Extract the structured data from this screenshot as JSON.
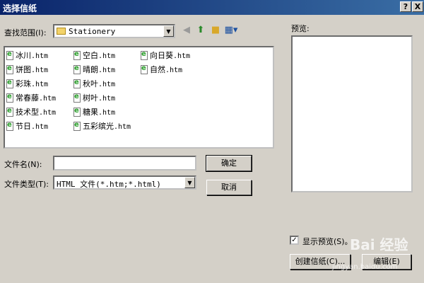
{
  "window": {
    "title": "选择信纸",
    "help": "?",
    "close": "X"
  },
  "lookin": {
    "label": "查找范围(I):",
    "value": "Stationery"
  },
  "files": [
    {
      "name": "冰川",
      "ext": ".htm"
    },
    {
      "name": "饼图",
      "ext": ".htm"
    },
    {
      "name": "彩珠",
      "ext": ".htm"
    },
    {
      "name": "常春藤",
      "ext": ".htm"
    },
    {
      "name": "技术型",
      "ext": ".htm"
    },
    {
      "name": "节日",
      "ext": ".htm"
    },
    {
      "name": "空白",
      "ext": ".htm"
    },
    {
      "name": "晴朗",
      "ext": ".htm"
    },
    {
      "name": "秋叶",
      "ext": ".htm"
    },
    {
      "name": "树叶",
      "ext": ".htm"
    },
    {
      "name": "糖果",
      "ext": ".htm"
    },
    {
      "name": "五彩缤光",
      "ext": ".htm"
    },
    {
      "name": "向日葵",
      "ext": ".htm"
    },
    {
      "name": "自然",
      "ext": ".htm"
    }
  ],
  "filename": {
    "label": "文件名(N):",
    "value": ""
  },
  "filetype": {
    "label": "文件类型(T):",
    "value": "HTML 文件(*.htm;*.html)"
  },
  "buttons": {
    "ok": "确定",
    "cancel": "取消",
    "create": "创建信纸(C)...",
    "edit": "编辑(E)"
  },
  "preview": {
    "label": "预览:",
    "show_label": "显示预览(S)。",
    "checked": "✓"
  },
  "watermark": {
    "text": "Bai 经验",
    "url": "jingyan.baidu.com"
  },
  "colors": {
    "titlebar": "#0a246a",
    "face": "#d4d0c8"
  }
}
